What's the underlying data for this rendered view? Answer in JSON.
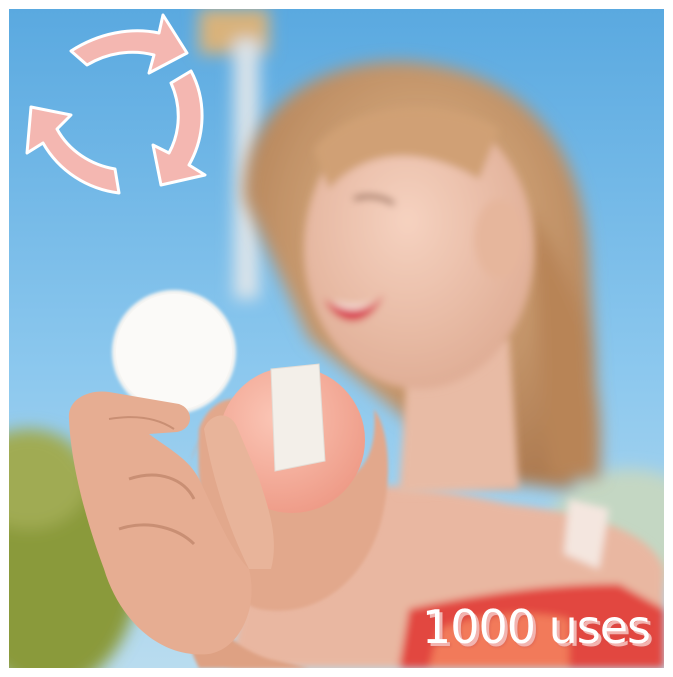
{
  "photo": {
    "subject": "photo-woman-holding-reusable-cotton-pad-and-case",
    "caption": "1000 uses",
    "colors": {
      "sky": "#6fb7e6",
      "recycle_icon": "#f4b7b1",
      "case": "#f7b09f",
      "caption_shadow": "#f2b4b0"
    }
  },
  "icons": {
    "recycle": "recycle-arrows-icon"
  }
}
